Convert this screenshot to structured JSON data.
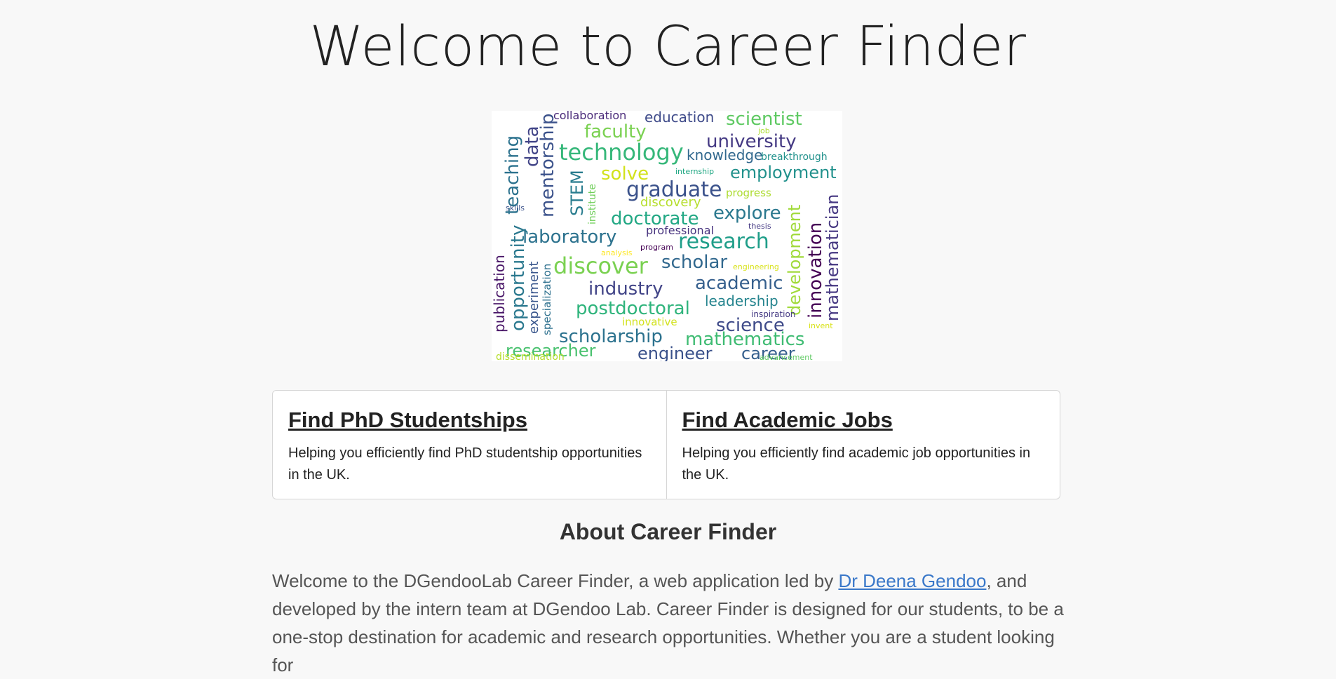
{
  "page": {
    "title": "Welcome to Career Finder",
    "wordcloud_words": [
      "collaboration",
      "education",
      "scientist",
      "job",
      "faculty",
      "university",
      "technology",
      "knowledge",
      "breakthrough",
      "teaching",
      "data",
      "mentorship",
      "solve",
      "employment",
      "internship",
      "STEM",
      "institute",
      "graduate",
      "progress",
      "discovery",
      "skills",
      "explore",
      "development",
      "doctorate",
      "thesis",
      "professional",
      "mathematician",
      "innovation",
      "laboratory",
      "research",
      "opportunity",
      "analysis",
      "program",
      "publication",
      "experiment",
      "specialization",
      "discover",
      "scholar",
      "engineering",
      "industry",
      "academic",
      "leadership",
      "postdoctoral",
      "inspiration",
      "innovative",
      "science",
      "scholarship",
      "mathematics",
      "invent",
      "researcher",
      "engineer",
      "career",
      "dissemination",
      "advancement"
    ]
  },
  "cards": [
    {
      "title": "Find PhD Studentships",
      "text": "Helping you efficiently find PhD studentship opportunities in the UK."
    },
    {
      "title": "Find Academic Jobs",
      "text": "Helping you efficiently find academic job opportunities in the UK."
    }
  ],
  "about": {
    "heading": "About Career Finder",
    "text_before": "Welcome to the DGendooLab Career Finder, a web application led by ",
    "link": "Dr Deena Gendoo",
    "text_after": ", and developed by the intern team at DGendoo Lab. Career Finder is designed for our students, to be a one-stop destination for academic and research opportunities. Whether you are a student looking for"
  },
  "colors": {
    "link": "#3a78c9",
    "background": "#f8f8f8"
  }
}
